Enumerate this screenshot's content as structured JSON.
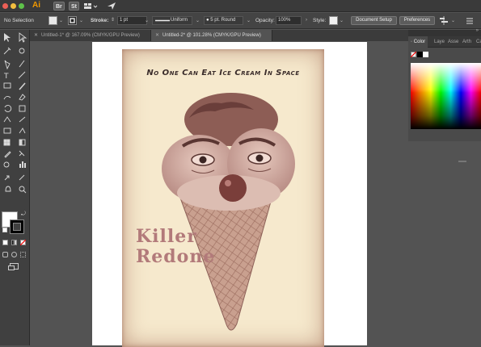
{
  "app": {
    "logo": "Ai",
    "bridge_label": "Br",
    "stock_label": "St"
  },
  "control_bar": {
    "selection_label": "No Selection",
    "stroke_label": "Stroke:",
    "stroke_value": "1 pt",
    "profile_value": "Uniform",
    "brush_value": "5 pt. Round",
    "opacity_label": "Opacity:",
    "opacity_value": "100%",
    "style_label": "Style:",
    "document_setup_label": "Document Setup",
    "preferences_label": "Preferences"
  },
  "tabs": [
    {
      "label": "Untitled-1* @ 167.09% (CMYK/GPU Preview)",
      "active": false
    },
    {
      "label": "Untitled-2* @ 101.28% (CMYK/GPU Preview)",
      "active": true
    }
  ],
  "panel": {
    "tabs": [
      "Color",
      "Laye",
      "Asse",
      "Arth",
      "Ca"
    ]
  },
  "poster": {
    "title": "No One Can Eat Ice Cream In Space",
    "headline_line1": "Killer",
    "headline_line2": "Redone"
  },
  "colors": {
    "poster_bg": "#f6e9cd",
    "headline": "#b27a7a",
    "accent_orange": "#f29900"
  }
}
